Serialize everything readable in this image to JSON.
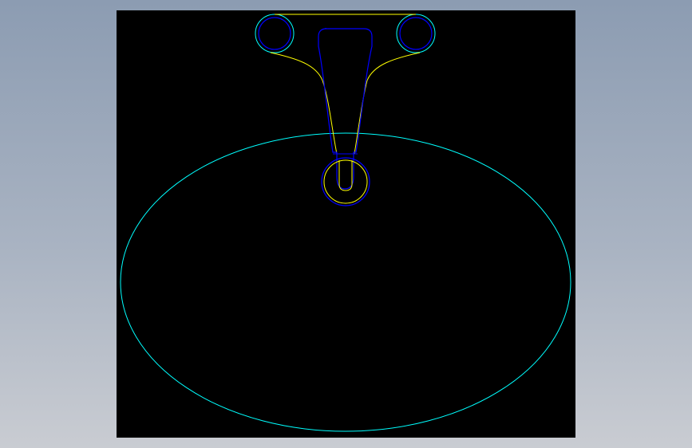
{
  "colors": {
    "background_top": "#8c9cb2",
    "background_bottom": "#c9ccd2",
    "canvas": "#000000",
    "outline_cyan": "#00ffff",
    "profile_yellow": "#ffff00",
    "profile_blue": "#0000ff"
  },
  "drawing": {
    "elements": [
      "outer-ellipse",
      "bracket-outline",
      "left-mount-hole",
      "right-mount-hole",
      "center-slot",
      "pivot-ring"
    ]
  }
}
